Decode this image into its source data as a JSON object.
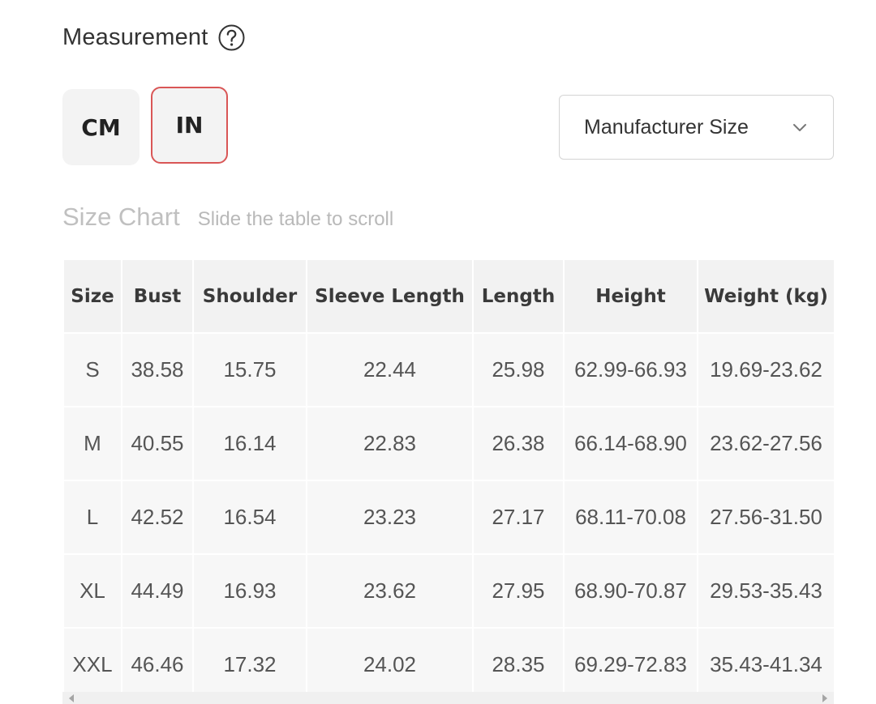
{
  "measurement": {
    "title": "Measurement",
    "help_icon": "question-circle-icon"
  },
  "units": {
    "cm_label": "CM",
    "in_label": "IN",
    "selected": "IN",
    "selected_border_color": "#d95656"
  },
  "size_select": {
    "value": "Manufacturer Size",
    "icon": "chevron-down-icon"
  },
  "size_chart": {
    "title": "Size Chart",
    "hint": "Slide the table to scroll",
    "columns": [
      "Size",
      "Bust",
      "Shoulder",
      "Sleeve Length",
      "Length",
      "Height",
      "Weight (kg)"
    ],
    "rows": [
      [
        "S",
        "38.58",
        "15.75",
        "22.44",
        "25.98",
        "62.99-66.93",
        "19.69-23.62"
      ],
      [
        "M",
        "40.55",
        "16.14",
        "22.83",
        "26.38",
        "66.14-68.90",
        "23.62-27.56"
      ],
      [
        "L",
        "42.52",
        "16.54",
        "23.23",
        "27.17",
        "68.11-70.08",
        "27.56-31.50"
      ],
      [
        "XL",
        "44.49",
        "16.93",
        "23.62",
        "27.95",
        "68.90-70.87",
        "29.53-35.43"
      ],
      [
        "XXL",
        "46.46",
        "17.32",
        "24.02",
        "28.35",
        "69.29-72.83",
        "35.43-41.34"
      ]
    ]
  }
}
